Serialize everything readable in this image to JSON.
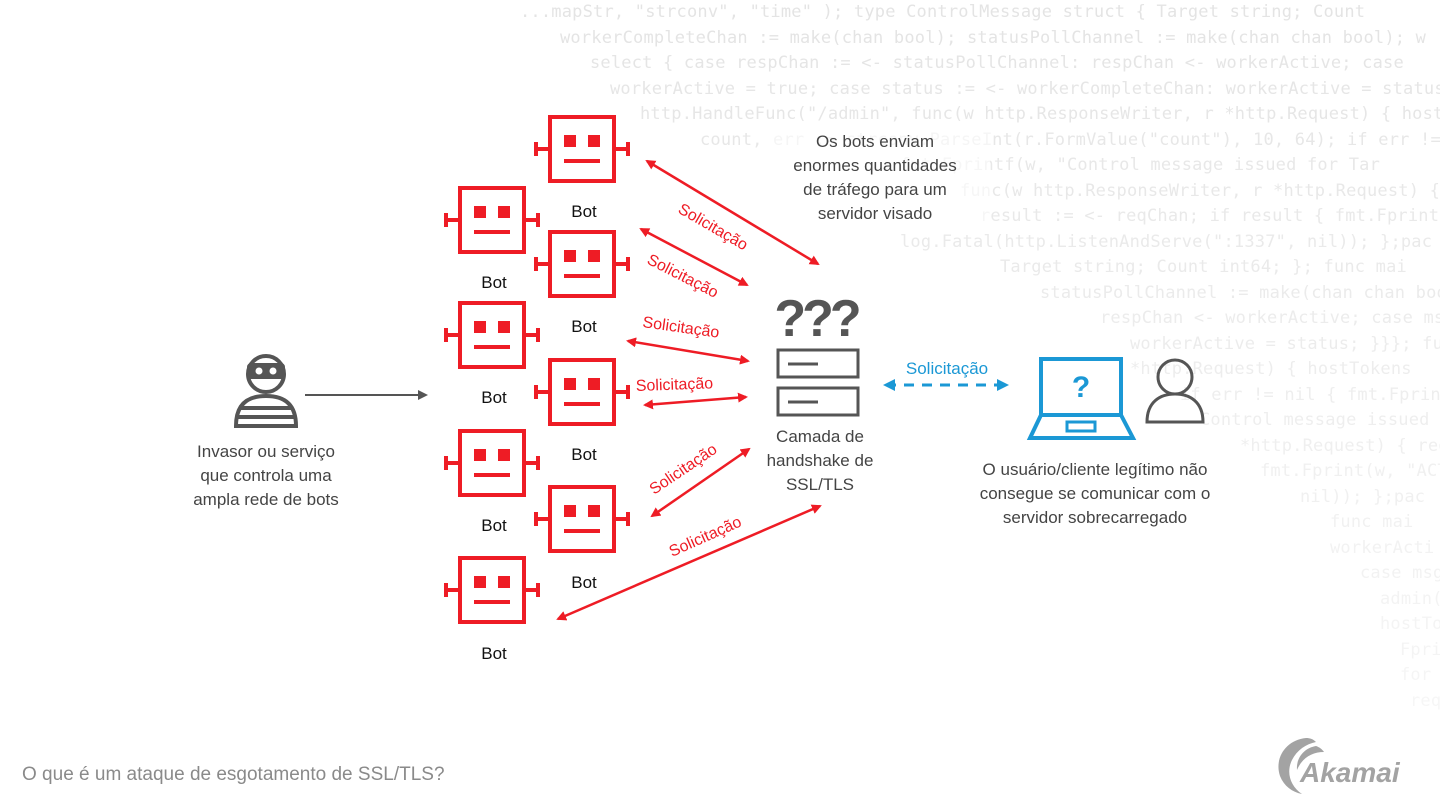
{
  "background_code": [
    "...mapStr, \"strconv\", \"time\" ); type ControlMessage struct { Target string; Count",
    "workerCompleteChan := make(chan bool); statusPollChannel := make(chan chan bool); w",
    "select { case respChan := <- statusPollChannel: respChan <- workerActive; case",
    "workerActive = true; case status := <- workerCompleteChan: workerActive = status;",
    "http.HandleFunc(\"/admin\", func(w http.ResponseWriter, r *http.Request) { hostTok",
    "count, err := strconv.ParseInt(r.FormValue(\"count\"), 10, 64); if err != nil { fmt.Fprintf(w,",
    "fmt.Fprintf(w, \"Control message issued for Tar",
    "func(w http.ResponseWriter, r *http.Request) { reqChan",
    "result := <- reqChan; if result { fmt.Fprint(w, \"ACTIVE\"",
    "log.Fatal(http.ListenAndServe(\":1337\", nil)); };pac",
    "Target string; Count int64; }; func mai",
    "statusPollChannel := make(chan chan bool); workerActi",
    "respChan <- workerActive; case msg := <-",
    "workerActive = status; }}}; func admin(c",
    "*http.Request) { hostTokens",
    "if err != nil { fmt.Fprintf(w,",
    "Control message issued for Tar",
    "*http.Request) { reqChan",
    "fmt.Fprint(w, \"ACTIVE\"",
    "nil)); };pac",
    "func mai",
    "workerActi",
    "case msg := <-",
    "admin(c",
    "hostTokens",
    "Fprintf(w,",
    "for Tar",
    "reqChan"
  ],
  "attacker": {
    "icon": "attacker-masked-person-icon",
    "label_lines": [
      "Invasor ou serviço",
      "que controla uma",
      "ampla rede de bots"
    ]
  },
  "bots": {
    "label": "Bot",
    "count": 8
  },
  "request_label": "Solicitação",
  "bots_note_lines": [
    "Os bots enviam",
    "enormes quantidades",
    "de tráfego para um",
    "servidor visado"
  ],
  "server": {
    "icon": "server-confused-icon",
    "question_marks": "???",
    "label_lines": [
      "Camada de",
      "handshake de",
      "SSL/TLS"
    ]
  },
  "client": {
    "request_label": "Solicitação",
    "laptop_icon": "laptop-question-icon",
    "laptop_glyph": "?",
    "user_icon": "user-icon",
    "label_lines": [
      "O usuário/cliente legítimo não",
      "consegue se comunicar com o",
      "servidor sobrecarregado"
    ]
  },
  "footer": {
    "title": "O que é um ataque de esgotamento de SSL/TLS?",
    "logo_text": "Akamai"
  },
  "colors": {
    "bot_red": "#ee1c25",
    "client_blue": "#1b98d5",
    "icon_gray": "#555555",
    "text_gray": "#444444",
    "footer_gray": "#8a8a8a"
  }
}
